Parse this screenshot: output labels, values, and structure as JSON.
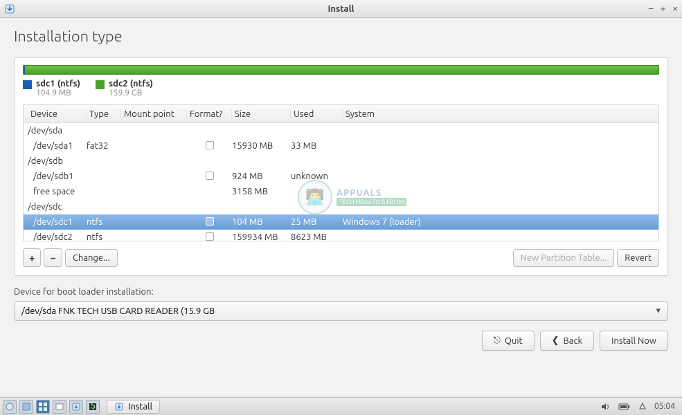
{
  "window": {
    "title": "Install"
  },
  "page": {
    "heading": "Installation type"
  },
  "legend": [
    {
      "name": "sdc1 (ntfs)",
      "size": "104.9 MB",
      "color": "blue"
    },
    {
      "name": "sdc2 (ntfs)",
      "size": "159.9 GB",
      "color": "green"
    }
  ],
  "table": {
    "headers": [
      "Device",
      "Type",
      "Mount point",
      "Format?",
      "Size",
      "Used",
      "System"
    ],
    "rows": [
      {
        "device": "/dev/sda",
        "type": "",
        "mount": "",
        "format": null,
        "size": "",
        "used": "",
        "system": "",
        "indent": false
      },
      {
        "device": "/dev/sda1",
        "type": "fat32",
        "mount": "",
        "format": false,
        "size": "15930 MB",
        "used": "33 MB",
        "system": "",
        "indent": true
      },
      {
        "device": "/dev/sdb",
        "type": "",
        "mount": "",
        "format": null,
        "size": "",
        "used": "",
        "system": "",
        "indent": false
      },
      {
        "device": "/dev/sdb1",
        "type": "",
        "mount": "",
        "format": false,
        "size": "924 MB",
        "used": "unknown",
        "system": "",
        "indent": true
      },
      {
        "device": "free space",
        "type": "",
        "mount": "",
        "format": null,
        "size": "3158 MB",
        "used": "",
        "system": "",
        "indent": true
      },
      {
        "device": "/dev/sdc",
        "type": "",
        "mount": "",
        "format": null,
        "size": "",
        "used": "",
        "system": "",
        "indent": false
      },
      {
        "device": "/dev/sdc1",
        "type": "ntfs",
        "mount": "",
        "format": false,
        "size": "104 MB",
        "used": "25 MB",
        "system": "Windows 7 (loader)",
        "indent": true,
        "selected": true
      },
      {
        "device": "/dev/sdc2",
        "type": "ntfs",
        "mount": "",
        "format": false,
        "size": "159934 MB",
        "used": "8623 MB",
        "system": "",
        "indent": true
      }
    ]
  },
  "toolbar": {
    "add": "+",
    "remove": "−",
    "change": "Change...",
    "new_table": "New Partition Table...",
    "revert": "Revert"
  },
  "boot": {
    "label": "Device for boot loader installation:",
    "value": "/dev/sda   FNK TECH USB CARD READER (15.9 GB"
  },
  "footer": {
    "quit": "Quit",
    "back": "Back",
    "install": "Install Now"
  },
  "taskbar": {
    "task": "Install",
    "clock": "05:04"
  },
  "watermark": {
    "brand": "APPUALS",
    "tagline": "TECH HOW-TO'S FROM"
  }
}
